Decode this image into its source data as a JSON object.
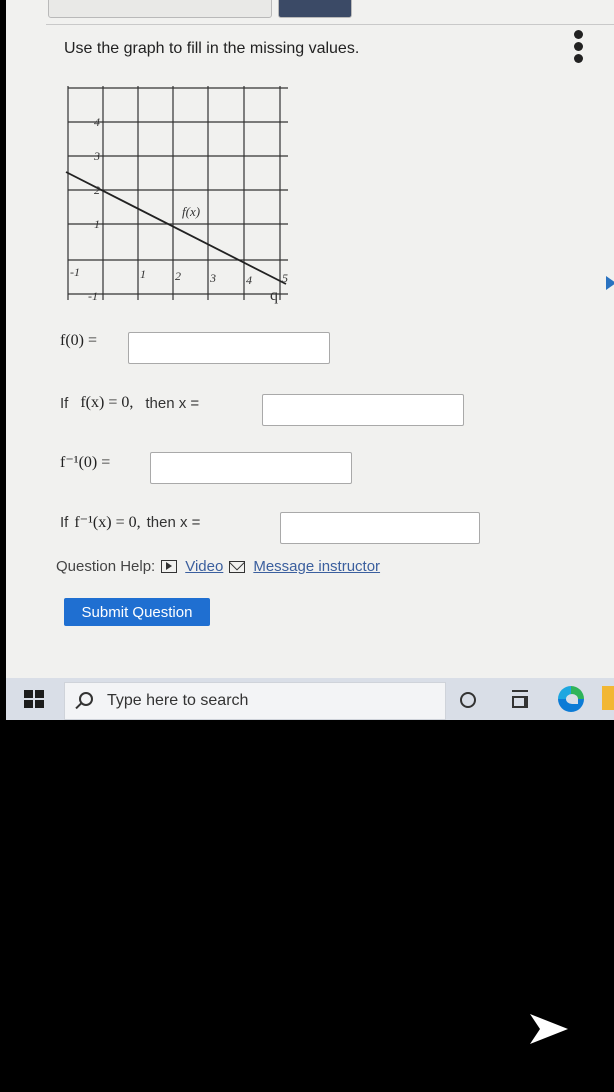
{
  "instruction": "Use the graph to fill in the missing values.",
  "graph": {
    "x_ticks": [
      "-1",
      "1",
      "2",
      "3",
      "4",
      "5"
    ],
    "y_ticks": [
      "4",
      "3",
      "2",
      "1",
      "-1"
    ],
    "function_label": "f(x)",
    "marker_label": "q"
  },
  "questions": [
    {
      "prefix": "",
      "expr": "f(0) =",
      "suffix": ""
    },
    {
      "prefix": "If",
      "expr": "f(x) = 0,",
      "suffix": "then  x ="
    },
    {
      "prefix": "",
      "expr": "f⁻¹(0) =",
      "suffix": ""
    },
    {
      "prefix": "If",
      "expr": "f⁻¹(x) = 0,",
      "suffix": "then  x ="
    }
  ],
  "help": {
    "label": "Question Help:",
    "video": "Video",
    "message": "Message instructor"
  },
  "submit_label": "Submit Question",
  "taskbar": {
    "search_placeholder": "Type here to search"
  },
  "icons": [
    "more-icon",
    "video-icon",
    "mail-icon",
    "windows-start-icon",
    "search-icon",
    "cortana-icon",
    "task-view-icon",
    "edge-icon",
    "folder-icon",
    "next-arrow-icon"
  ],
  "colors": {
    "accent": "#1f6fd1",
    "link": "#3b5f9e"
  }
}
